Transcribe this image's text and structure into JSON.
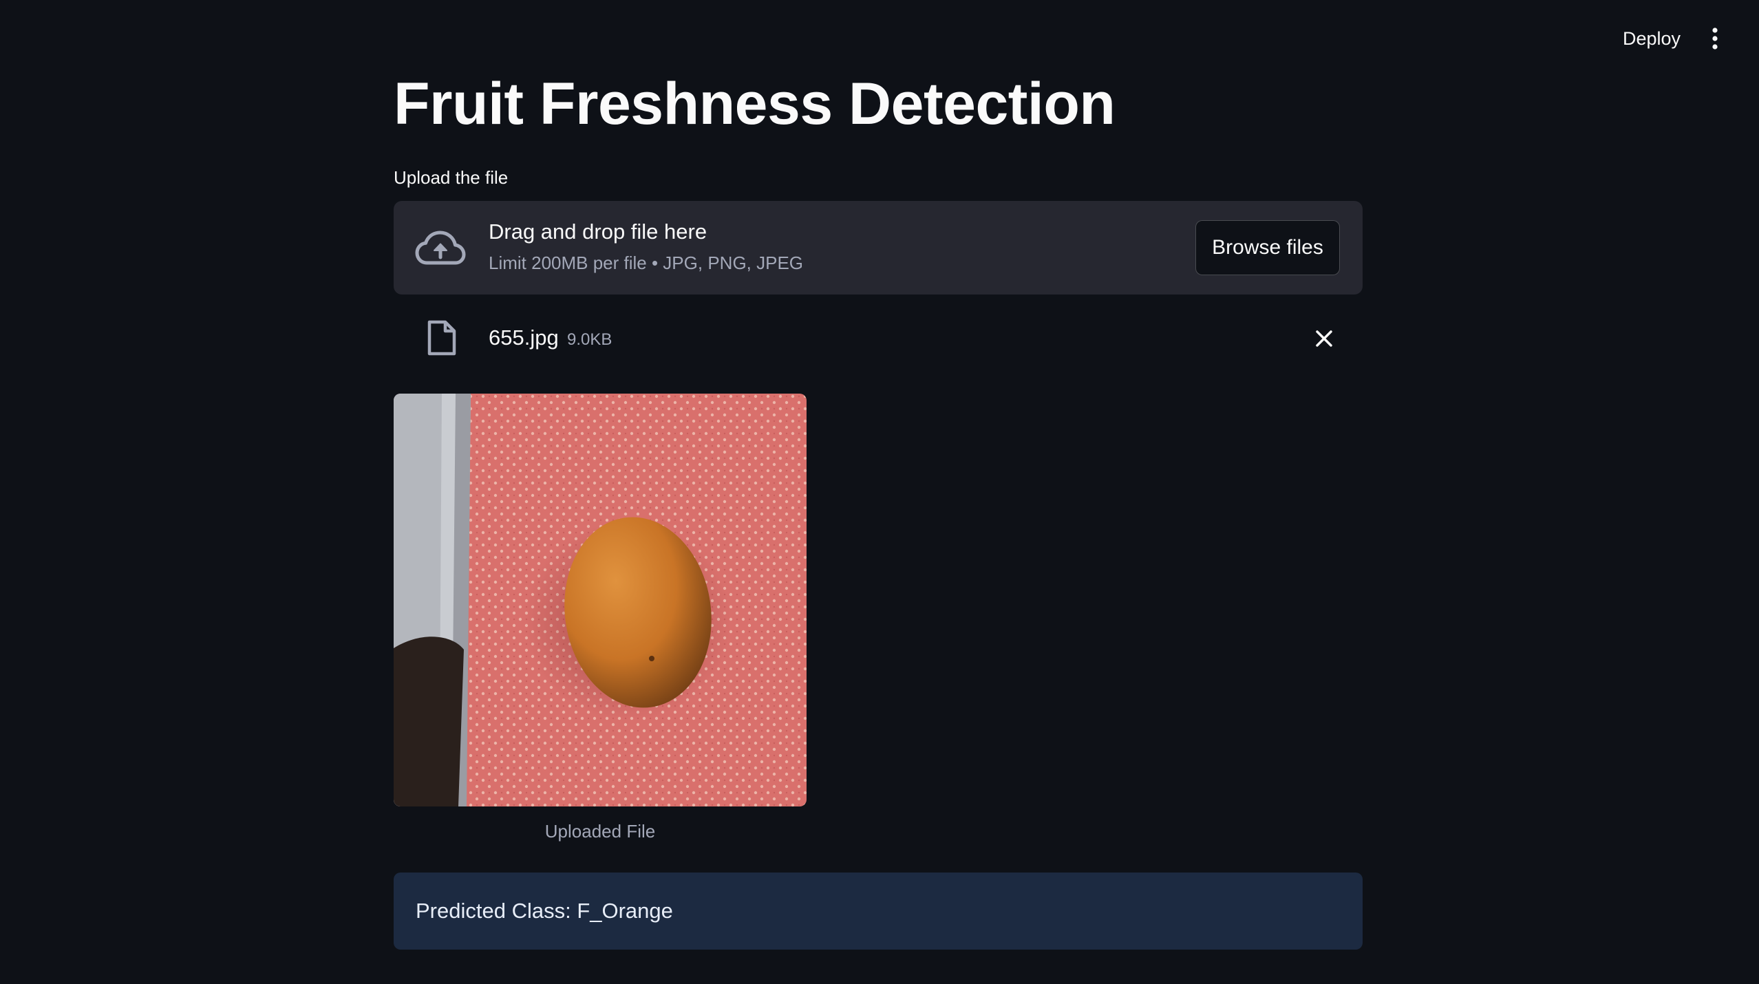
{
  "header": {
    "deploy_label": "Deploy",
    "menu_icon": "vertical-ellipsis-icon"
  },
  "main": {
    "title": "Fruit Freshness Detection",
    "uploader": {
      "label": "Upload the file",
      "dropzone_title": "Drag and drop file here",
      "dropzone_subtitle": "Limit 200MB per file • JPG, PNG, JPEG",
      "browse_label": "Browse files",
      "icon": "cloud-upload-icon"
    },
    "file": {
      "name": "655.jpg",
      "size": "9.0KB",
      "icon": "file-icon",
      "remove_icon": "close-icon"
    },
    "image": {
      "caption": "Uploaded File"
    },
    "result": {
      "text": "Predicted Class: F_Orange"
    }
  },
  "colors": {
    "background": "#0e1117",
    "dropzone": "#262730",
    "info_alert": "#1c2a41",
    "text": "#fafafa",
    "muted_text": "#a3a8b8"
  }
}
